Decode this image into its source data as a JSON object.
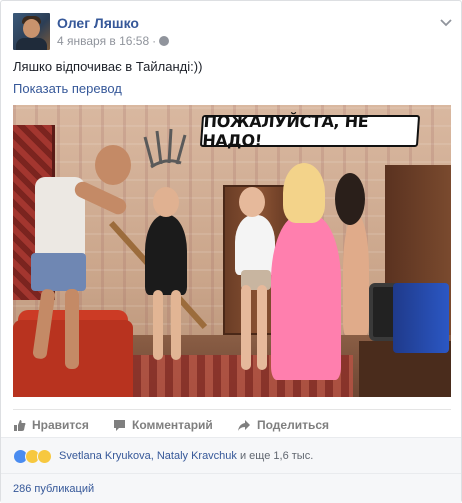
{
  "post": {
    "author": "Олег Ляшко",
    "date": "4 января в 16:58",
    "separator": "·",
    "text": "Ляшко відпочиває в Тайланді:))",
    "translate_link": "Показать перевод",
    "photo_caption": "ПОЖАЛУЙСТА, НЕ НАДО!",
    "icons": [
      "globe-icon",
      "chevron-down-icon"
    ]
  },
  "actions": {
    "like_label": "Нравится",
    "comment_label": "Комментарий",
    "share_label": "Поделиться"
  },
  "reactions": {
    "names": "Svetlana Kryukova, Nataly Kravchuk",
    "suffix": " и еще 1,6 тыс.",
    "icons": [
      "like-reaction-icon",
      "haha-reaction-icon",
      "wow-reaction-icon"
    ]
  },
  "shares": {
    "label": "286 публикаций"
  },
  "colors": {
    "link": "#365899",
    "muted": "#90949c",
    "like_blue": "#4a8cf0",
    "emoji_yellow": "#f7c840"
  }
}
